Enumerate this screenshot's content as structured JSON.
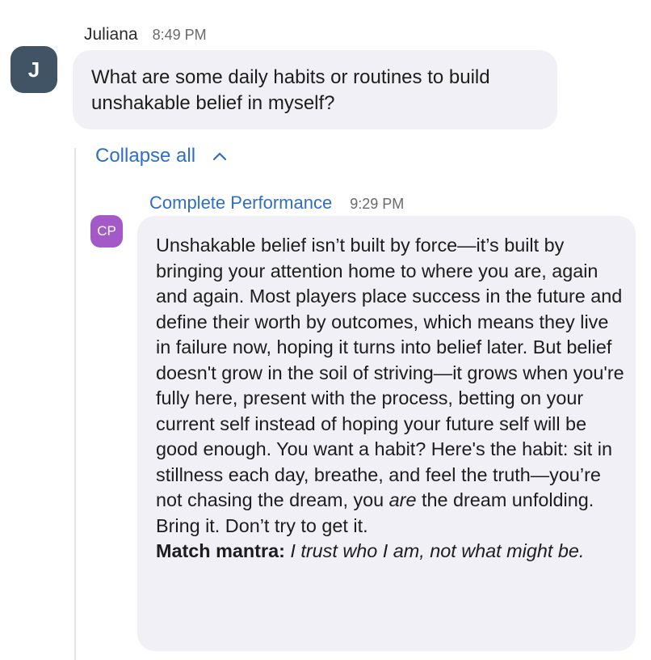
{
  "message": {
    "sender": "Juliana",
    "time": "8:49 PM",
    "avatar_initial": "J",
    "text": "What are some daily habits or routines to build unshakable belief in myself?"
  },
  "thread": {
    "collapse_label": "Collapse all",
    "collapse_icon": "chevron-up-icon"
  },
  "reply": {
    "sender": "Complete Performance",
    "time": "9:29 PM",
    "avatar_initials": "CP",
    "body_before": "Unshakable belief isn’t built by force—it’s built by bringing your attention home to where you are, again and again. Most players place success in the future and define their worth by outcomes, which means they live in failure now, hoping it turns into belief later. But belief doesn't grow in the soil of striving—it grows when you're fully here, present with the process, betting on your current self instead of hoping your future self will be good enough. You want a habit? Here's the habit: sit in stillness each day, breathe, and feel the truth—you’re not chasing the dream, you",
    "body_emphasis": "are",
    "body_after": "the dream unfolding. Bring it. Don’t try to get it.",
    "mantra_label": "Match mantra:",
    "mantra_text": "I trust who I am, not what might be."
  },
  "colors": {
    "avatar_j": "#405466",
    "avatar_cp": "#a35ac8",
    "bubble": "#f1f0f6",
    "link": "#2e6fc5"
  }
}
